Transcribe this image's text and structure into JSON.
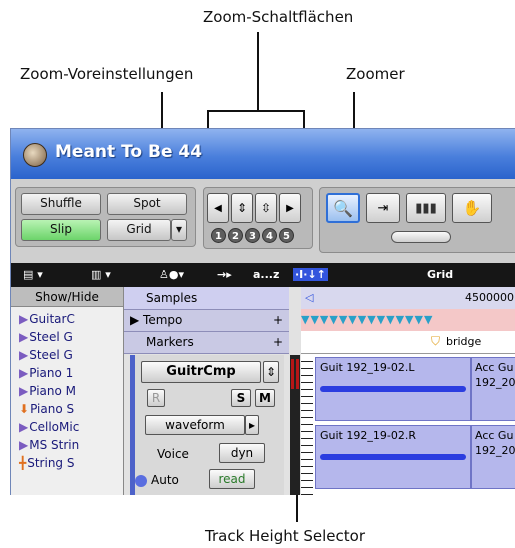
{
  "callouts": {
    "zoom_buttons": "Zoom-Schaltflächen",
    "zoom_presets": "Zoom-Voreinstellungen",
    "zoomer": "Zoomer",
    "track_height": "Track Height Selector"
  },
  "window": {
    "title": "Meant To Be 44"
  },
  "toolbar": {
    "edit_modes": {
      "shuffle": "Shuffle",
      "spot": "Spot",
      "slip": "Slip",
      "grid": "Grid"
    },
    "zoom_presets": [
      "1",
      "2",
      "3",
      "4",
      "5"
    ]
  },
  "midbar": {
    "az": "a...z",
    "grid": "Grid"
  },
  "left": {
    "show_hide": "Show/Hide",
    "tracks": [
      "GuitarC",
      "Steel G",
      "Steel G",
      "Piano 1",
      "Piano M",
      "Piano S",
      "CelloMic",
      "MS Strin",
      "String S"
    ]
  },
  "rulers": {
    "samples": "Samples",
    "tempo": "Tempo",
    "markers": "Markers",
    "sample_value": "4500000"
  },
  "strip": {
    "name": "GuitrCmp",
    "r": "R",
    "s": "S",
    "m": "M",
    "view": "waveform",
    "voice": "Voice",
    "voice_val": "dyn",
    "auto": "Auto",
    "auto_val": "read"
  },
  "edit": {
    "marker": "bridge",
    "clips": [
      "Guit 192_19-02.L",
      "Acc Gu",
      "192_20",
      "Guit 192_19-02.R",
      "Acc Gu",
      "192_20"
    ]
  },
  "colors": {
    "accent": "#2f6fd7",
    "title_bar": "#4a7fdc",
    "slip_green": "#6cd46a",
    "waveform": "#2b3de0"
  }
}
